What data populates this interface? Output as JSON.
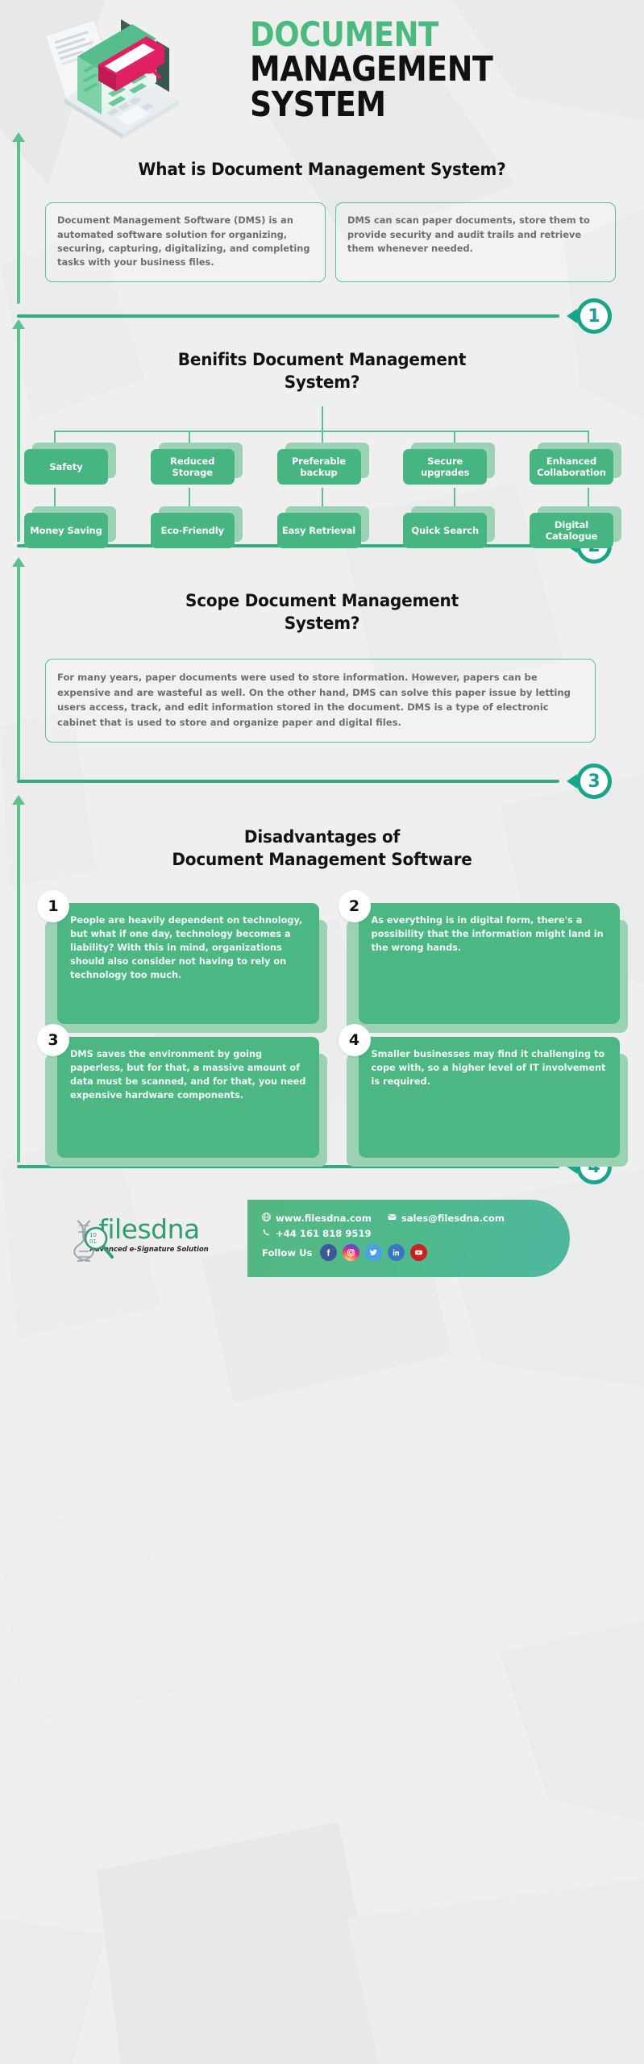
{
  "header": {
    "title_line1": "DOCUMENT",
    "title_line2": "MANAGEMENT",
    "title_line3": "SYSTEM",
    "accent_color": "#4cb97f"
  },
  "section1": {
    "badge": "1",
    "title": "What is Document Management System?",
    "box1": "Document Management Software (DMS) is an  automated software solution for organizing, securing, capturing, digitalizing, and completing tasks with your business files.",
    "box2": "DMS can scan paper documents, store them to provide security and audit trails and retrieve them whenever needed."
  },
  "section2": {
    "badge": "2",
    "title_line1": "Benifits Document Management",
    "title_line2": "System?",
    "row1": [
      "Safety",
      "Reduced Storage",
      "Preferable backup",
      "Secure upgrades",
      "Enhanced Collaboration"
    ],
    "row2": [
      "Money Saving",
      "Eco-Friendly",
      "Easy Retrieval",
      "Quick Search",
      "Digital Catalogue"
    ]
  },
  "section3": {
    "badge": "3",
    "title_line1": "Scope Document Management",
    "title_line2": "System?",
    "body": "For many years, paper documents were used to store information. However, papers can be expensive and are wasteful as well. On the other hand, DMS can solve this paper issue by letting users access, track, and edit information stored in the document. DMS is a type of electronic cabinet that is used to store and organize paper and digital files."
  },
  "section4": {
    "badge": "4",
    "title_line1": "Disadvantages of",
    "title_line2": "Document Management Software",
    "cards": [
      {
        "num": "1",
        "text": "People are heavily dependent on technology, but what if one day, technology becomes a liability? With this in mind, organizations should also consider not having to rely on technology too much."
      },
      {
        "num": "2",
        "text": "As everything is in digital form, there's a possibility that the information might land in the wrong hands."
      },
      {
        "num": "3",
        "text": "DMS saves the environment by going paperless, but for that, a massive amount of data must be scanned, and for that, you need expensive hardware components."
      },
      {
        "num": "4",
        "text": "Smaller businesses may find it challenging to cope with, so a higher level of IT involvement is required."
      }
    ]
  },
  "footer": {
    "logo_name": "filesdna",
    "logo_tagline": "Advanced e-Signature Solution",
    "website": "www.filesdna.com",
    "email": "sales@filesdna.com",
    "phone": "+44 161 818 9519",
    "follow_label": "Follow Us",
    "socials": [
      {
        "name": "facebook",
        "glyph": "f"
      },
      {
        "name": "instagram",
        "glyph": "▢"
      },
      {
        "name": "twitter",
        "glyph": "𝐓"
      },
      {
        "name": "linkedin",
        "glyph": "in"
      },
      {
        "name": "youtube",
        "glyph": "▶"
      }
    ]
  }
}
